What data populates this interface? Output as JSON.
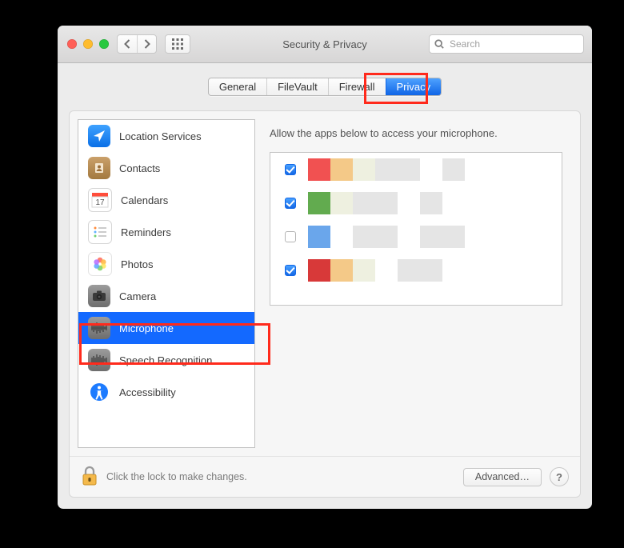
{
  "window": {
    "title": "Security & Privacy"
  },
  "search": {
    "placeholder": "Search",
    "value": ""
  },
  "tabs": [
    {
      "label": "General",
      "selected": false
    },
    {
      "label": "FileVault",
      "selected": false
    },
    {
      "label": "Firewall",
      "selected": false
    },
    {
      "label": "Privacy",
      "selected": true
    }
  ],
  "sidebar": {
    "items": [
      {
        "label": "Location Services",
        "icon": "location-icon",
        "selected": false
      },
      {
        "label": "Contacts",
        "icon": "contacts-icon",
        "selected": false
      },
      {
        "label": "Calendars",
        "icon": "calendar-icon",
        "selected": false
      },
      {
        "label": "Reminders",
        "icon": "reminders-icon",
        "selected": false
      },
      {
        "label": "Photos",
        "icon": "photos-icon",
        "selected": false
      },
      {
        "label": "Camera",
        "icon": "camera-icon",
        "selected": false
      },
      {
        "label": "Microphone",
        "icon": "microphone-icon",
        "selected": true
      },
      {
        "label": "Speech Recognition",
        "icon": "speech-icon",
        "selected": false
      },
      {
        "label": "Accessibility",
        "icon": "accessibility-icon",
        "selected": false
      }
    ]
  },
  "right": {
    "description": "Allow the apps below to access your microphone.",
    "apps": [
      {
        "checked": true
      },
      {
        "checked": true
      },
      {
        "checked": false
      },
      {
        "checked": true
      }
    ]
  },
  "footer": {
    "lock_text": "Click the lock to make changes.",
    "advanced_label": "Advanced…"
  },
  "highlights": {
    "privacy_tab": true,
    "microphone_row": true
  },
  "colors": {
    "selection": "#1369ff",
    "highlight_border": "#ff2a1c"
  }
}
